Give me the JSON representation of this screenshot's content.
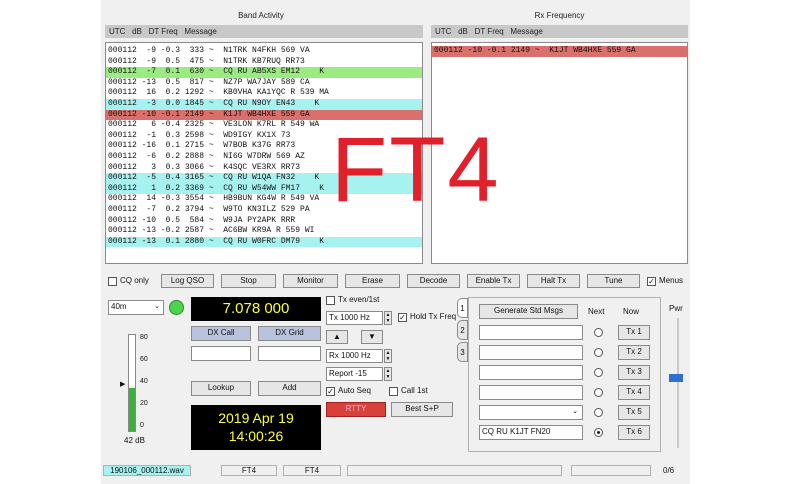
{
  "band_activity": {
    "title": "Band Activity",
    "columns": "UTC   dB   DT Freq   Message",
    "rows": [
      {
        "text": "000112  -9 -0.3  333 ~  N1TRK N4FKH 569 VA",
        "hl": ""
      },
      {
        "text": "000112  -9  0.5  475 ~  N1TRK KB7RUQ RR73",
        "hl": ""
      },
      {
        "text": "000112  -7  0.1  630 ~  CQ RU AB5XS EM12    K",
        "hl": "me"
      },
      {
        "text": "000112 -13  0.5  817 ~  NZ7P WA7JAY 589 CA",
        "hl": ""
      },
      {
        "text": "000112  16  0.2 1292 ~  KB0VHA KA1YQC R 539 MA",
        "hl": ""
      },
      {
        "text": "000112  -3  0.0 1845 ~  CQ RU N9OY EN43    K",
        "hl": "cq"
      },
      {
        "text": "000112 -10 -0.1 2149 ~  K1JT WB4HXE 559 GA",
        "hl": "tx"
      },
      {
        "text": "000112   6 -0.4 2325 ~  VE3LON K7RL R 549 WA",
        "hl": ""
      },
      {
        "text": "000112  -1  0.3 2598 ~  WD9IGY KX1X 73",
        "hl": ""
      },
      {
        "text": "000112 -16  0.1 2715 ~  W7BOB K37G RR73",
        "hl": ""
      },
      {
        "text": "000112  -6  0.2 2888 ~  NI6G W7DRW 569 AZ",
        "hl": ""
      },
      {
        "text": "000112   3  0.3 3066 ~  K4SQC VE3RX RR73",
        "hl": ""
      },
      {
        "text": "000112  -5  0.4 3165 ~  CQ RU W1QA FN32    K",
        "hl": "cq"
      },
      {
        "text": "000112   1  0.2 3369 ~  CQ RU W54WW FM17    K",
        "hl": "cq"
      },
      {
        "text": "000112  14 -0.3 3554 ~  HB9BUN KG4W R 549 VA",
        "hl": ""
      },
      {
        "text": "000112  -7  0.2 3794 ~  W9TO KN3ILZ 529 PA",
        "hl": ""
      },
      {
        "text": "000112 -10  0.5  584 ~  W9JA PY2APK RRR",
        "hl": ""
      },
      {
        "text": "000112 -13 -0.2 2587 ~  AC6BW KR9A R 559 WI",
        "hl": ""
      },
      {
        "text": "000112 -13  0.1 2880 ~  CQ RU W0FRC DM79    K",
        "hl": "cq"
      }
    ]
  },
  "rx_frequency": {
    "title": "Rx Frequency",
    "columns": "UTC   dB   DT Freq   Message",
    "rows": [
      {
        "text": "000112 -10 -0.1 2149 ~  K1JT WB4HXE 559 GA",
        "hl": "tx"
      }
    ]
  },
  "overlay_text": "FT4",
  "controls": {
    "cq_only": "CQ only",
    "log_qso": "Log QSO",
    "stop": "Stop",
    "monitor": "Monitor",
    "erase": "Erase",
    "decode": "Decode",
    "enable_tx": "Enable Tx",
    "halt_tx": "Halt Tx",
    "tune": "Tune",
    "menus": "Menus"
  },
  "band": "40m",
  "frequency": "7.078 000",
  "dx_call_label": "DX Call",
  "dx_grid_label": "DX Grid",
  "lookup": "Lookup",
  "add": "Add",
  "date": "2019 Apr 19",
  "time": "14:00:26",
  "tx_even": "Tx even/1st",
  "tx_hz": "Tx  1000  Hz",
  "hold_tx_freq": "Hold Tx Freq",
  "rx_hz": "Rx  1000  Hz",
  "report": "Report  -15",
  "auto_seq": "Auto Seq",
  "call_1st": "Call 1st",
  "rtty": "RTTY",
  "best_sp": "Best S+P",
  "meter": {
    "ticks": [
      "80",
      "60",
      "40",
      "20",
      "0"
    ],
    "level_db": "42 dB",
    "level_fraction": 0.45
  },
  "tabs": [
    "1",
    "2",
    "3"
  ],
  "messages": {
    "generate": "Generate Std Msgs",
    "next": "Next",
    "now": "Now",
    "tx_buttons": [
      "Tx 1",
      "Tx 2",
      "Tx 3",
      "Tx 4",
      "Tx 5",
      "Tx 6"
    ],
    "tx6_text": "CQ RU K1JT FN20",
    "selected_next": 6
  },
  "pwr": "Pwr",
  "status": {
    "file": "190106_000112.wav",
    "mode1": "FT4",
    "mode2": "FT4",
    "count": "0/6"
  },
  "colors": {
    "cq": "#a6f2f0",
    "my_call": "#9bec80",
    "tx": "#d9706b",
    "freq_display": "#ffff33",
    "overlay": "#e0202a"
  }
}
